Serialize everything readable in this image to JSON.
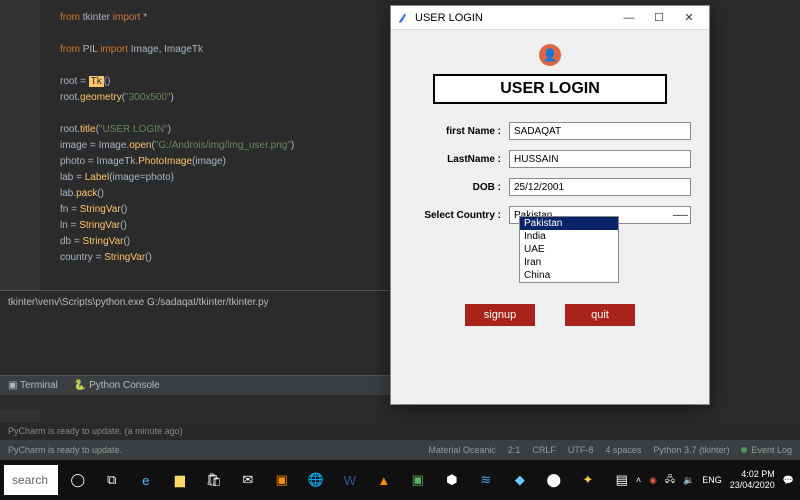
{
  "editor": {
    "lines": [
      "from tkinter import *",
      "",
      "from PIL import Image, ImageTk",
      "",
      "root = Tk()",
      "root.geometry(\"300x500\")",
      "",
      "root.title(\"USER LOGIN\")",
      "image = Image.open(\"G:/Androis/img/img_user.png\")",
      "photo = ImageTk.PhotoImage(image)",
      "lab = Label(image=photo)",
      "lab.pack()",
      "fn = StringVar()",
      "ln = StringVar()",
      "db = StringVar()",
      "country = StringVar()"
    ]
  },
  "terminal": {
    "line": "tkinter\\venv\\Scripts\\python.exe G:/sadaqat/tkinter/tkinter.py",
    "tabs": [
      "▣ Terminal",
      "🐍 Python Console"
    ]
  },
  "ide_status": {
    "ready_left": "PyCharm is ready to update.",
    "ready_right": "PyCharm is ready to update.",
    "material": "Material Oceanic",
    "pos": "2:1",
    "crlf": "CRLF",
    "enc": "UTF-8",
    "spaces": "4 spaces",
    "python": "Python 3.7 (tkinter)",
    "eventlog": "Event Log",
    "update_age": "(a minute ago)"
  },
  "tkwin": {
    "title": "USER LOGIN",
    "heading": "USER LOGIN",
    "labels": {
      "fn": "first Name :",
      "ln": "LastName :",
      "dob": "DOB :",
      "country": "Select Country :"
    },
    "values": {
      "fn": "SADAQAT",
      "ln": "HUSSAIN",
      "dob": "25/12/2001",
      "country": "Pakistan"
    },
    "dropdown": [
      "Pakistan",
      "India",
      "UAE",
      "Iran",
      "China"
    ],
    "buttons": {
      "signup": "signup",
      "quit": "quit"
    }
  },
  "taskbar": {
    "search_placeholder": "search",
    "tray": {
      "net": "🖧",
      "lang": "ENG",
      "time": "4:02 PM",
      "date": "23/04/2020"
    }
  }
}
